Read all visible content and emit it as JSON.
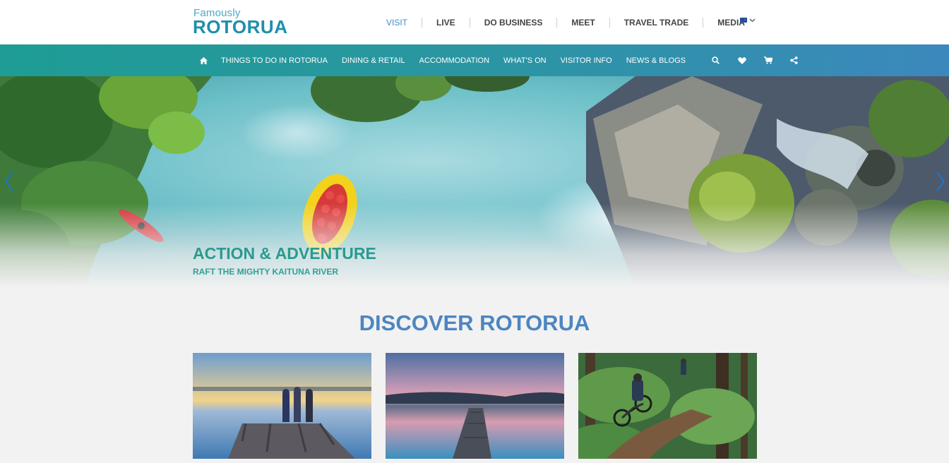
{
  "logo": {
    "small": "Famously",
    "big": "ROTORUA"
  },
  "topnav": [
    "VISIT",
    "LIVE",
    "DO BUSINESS",
    "MEET",
    "TRAVEL TRADE",
    "MEDIA"
  ],
  "mainnav": [
    "THINGS TO DO IN ROTORUA",
    "DINING & RETAIL",
    "ACCOMMODATION",
    "WHAT'S ON",
    "VISITOR INFO",
    "NEWS & BLOGS"
  ],
  "hero": {
    "title": "ACTION & ADVENTURE",
    "subtitle": "RAFT THE MIGHTY KAITUNA RIVER"
  },
  "discover": {
    "title": "DISCOVER ROTORUA"
  },
  "icons": [
    "home-icon",
    "search-icon",
    "heart-icon",
    "cart-icon",
    "share-icon",
    "chevron-left-icon",
    "chevron-right-icon",
    "chevron-down-icon",
    "nz-flag-icon"
  ],
  "colors": {
    "nav_start": "#1e9c95",
    "nav_end": "#3c88bd",
    "accent": "#2a9a8e",
    "heading": "#4d86c0",
    "active_link": "#3c8dbc"
  }
}
